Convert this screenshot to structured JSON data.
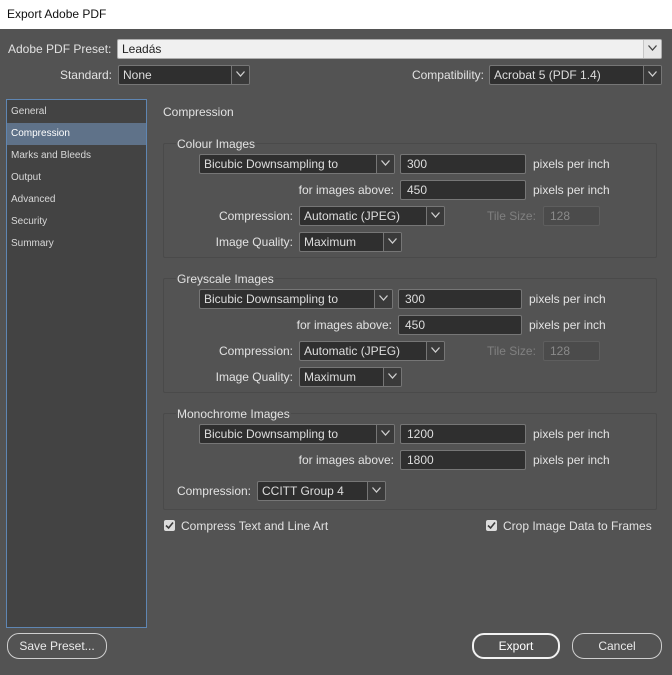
{
  "window": {
    "title": "Export Adobe PDF"
  },
  "header": {
    "preset_label": "Adobe PDF Preset:",
    "preset_value": "Leadás",
    "standard_label": "Standard:",
    "standard_value": "None",
    "compat_label": "Compatibility:",
    "compat_value": "Acrobat 5 (PDF 1.4)"
  },
  "sidebar": {
    "items": [
      {
        "label": "General",
        "selected": false
      },
      {
        "label": "Compression",
        "selected": true
      },
      {
        "label": "Marks and Bleeds",
        "selected": false
      },
      {
        "label": "Output",
        "selected": false
      },
      {
        "label": "Advanced",
        "selected": false
      },
      {
        "label": "Security",
        "selected": false
      },
      {
        "label": "Summary",
        "selected": false
      }
    ]
  },
  "main": {
    "section_title": "Compression",
    "colour": {
      "title": "Colour Images",
      "downsampling": "Bicubic Downsampling to",
      "ppi": "300",
      "unit": "pixels per inch",
      "above_label": "for images above:",
      "above_value": "450",
      "above_unit": "pixels per inch",
      "compression_label": "Compression:",
      "compression_value": "Automatic (JPEG)",
      "tile_label": "Tile Size:",
      "tile_value": "128",
      "quality_label": "Image Quality:",
      "quality_value": "Maximum"
    },
    "greyscale": {
      "title": "Greyscale Images",
      "downsampling": "Bicubic Downsampling to",
      "ppi": "300",
      "unit": "pixels per inch",
      "above_label": "for images above:",
      "above_value": "450",
      "above_unit": "pixels per inch",
      "compression_label": "Compression:",
      "compression_value": "Automatic (JPEG)",
      "tile_label": "Tile Size:",
      "tile_value": "128",
      "quality_label": "Image Quality:",
      "quality_value": "Maximum"
    },
    "monochrome": {
      "title": "Monochrome Images",
      "downsampling": "Bicubic Downsampling to",
      "ppi": "1200",
      "unit": "pixels per inch",
      "above_label": "for images above:",
      "above_value": "1800",
      "above_unit": "pixels per inch",
      "compression_label": "Compression:",
      "compression_value": "CCITT Group 4"
    },
    "compress_text_label": "Compress Text and Line Art",
    "compress_text_checked": true,
    "crop_label": "Crop Image Data to Frames",
    "crop_checked": true
  },
  "footer": {
    "save_preset": "Save Preset...",
    "export": "Export",
    "cancel": "Cancel"
  },
  "icons": {
    "dropdown": "chevron-down-icon",
    "checkbox": "checkmark-icon"
  },
  "colors": {
    "background": "#535353",
    "field": "#2f2f2f",
    "selection": "#5f7289",
    "sidebar_border": "#5f86b3"
  }
}
